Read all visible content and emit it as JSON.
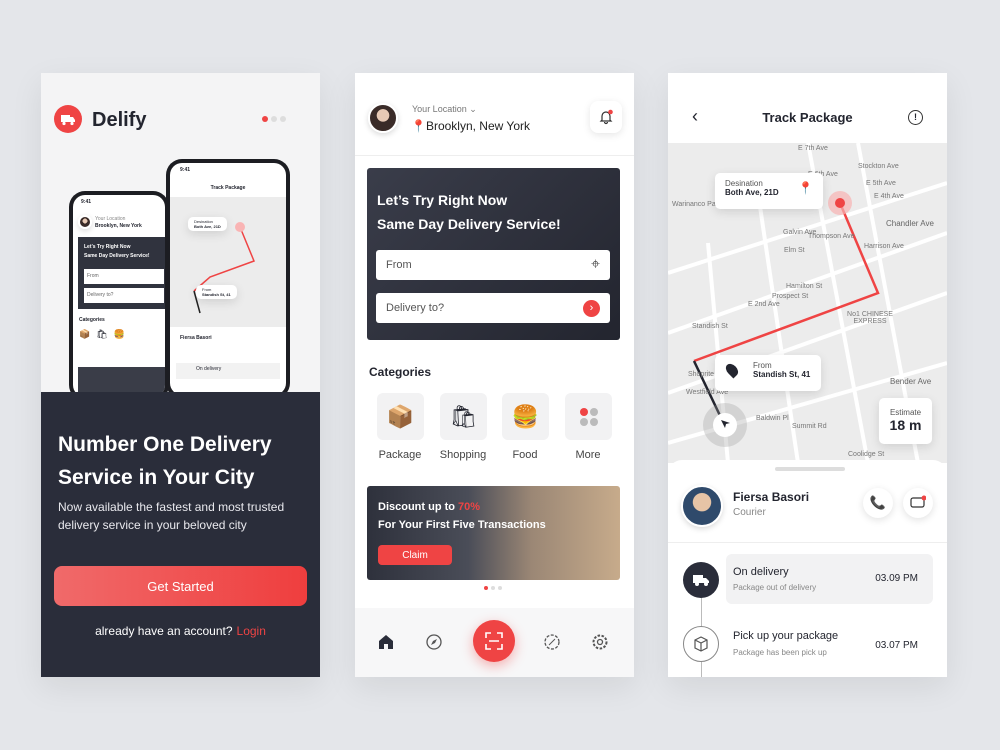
{
  "colors": {
    "accent": "#ef4444",
    "dark": "#2a2d3a",
    "background": "#e4e6ea"
  },
  "onboarding": {
    "brand": "Delify",
    "headline_1": "Number One Delivery",
    "headline_2": "Service in Your City",
    "subtitle": "Now available the fastest and most trusted delivery service in your beloved city",
    "cta": "Get Started",
    "account_prompt": "already have an account?",
    "login": "Login",
    "phone_time": "9:41"
  },
  "home": {
    "location_label": "Your Location",
    "location": "Brooklyn, New York",
    "promo_line1": "Let’s Try Right Now",
    "promo_line2": "Same Day Delivery Service!",
    "from_placeholder": "From",
    "to_placeholder": "Delivery to?",
    "categories_title": "Categories",
    "categories": [
      {
        "label": "Package",
        "icon": "📦"
      },
      {
        "label": "Shopping",
        "icon": "🛍"
      },
      {
        "label": "Food",
        "icon": "🍔"
      },
      {
        "label": "More",
        "icon": "more"
      }
    ],
    "banner": {
      "text": "Discount up to ",
      "highlight": "70%",
      "line2": "For Your First Five Transactions",
      "button": "Claim"
    },
    "nav": [
      "home-icon",
      "compass-icon",
      "scan-icon",
      "discount-icon",
      "settings-icon"
    ]
  },
  "track": {
    "title": "Track Package",
    "destination_label": "Desination",
    "destination": "Both Ave, 21D",
    "from_label": "From",
    "from": "Standish St, 41",
    "estimate_label": "Estimate",
    "estimate": "18 m",
    "streets": [
      "E 7th Ave",
      "E 6th Ave",
      "Stockton Ave",
      "E 5th Ave",
      "E 4th Ave",
      "Warinanco Park",
      "Galvin Ave",
      "Elm St",
      "Thompson Ave",
      "Harrison Ave",
      "Chandler Ave",
      "E 2nd Ave",
      "Prospect St",
      "Hamilton St",
      "Standish St",
      "No1 CHINESE EXPRESS",
      "Westfield Ave",
      "Baldwin Pl",
      "Summit Rd",
      "Bender Ave",
      "Shoprite",
      "Coolidge St"
    ],
    "courier": {
      "name": "Fiersa Basori",
      "role": "Courier"
    },
    "timeline": [
      {
        "title": "On delivery",
        "desc": "Package out of delivery",
        "time": "03.09 PM"
      },
      {
        "title": "Pick up your package",
        "desc": "Package has been pick up",
        "time": "03.07 PM"
      }
    ]
  }
}
